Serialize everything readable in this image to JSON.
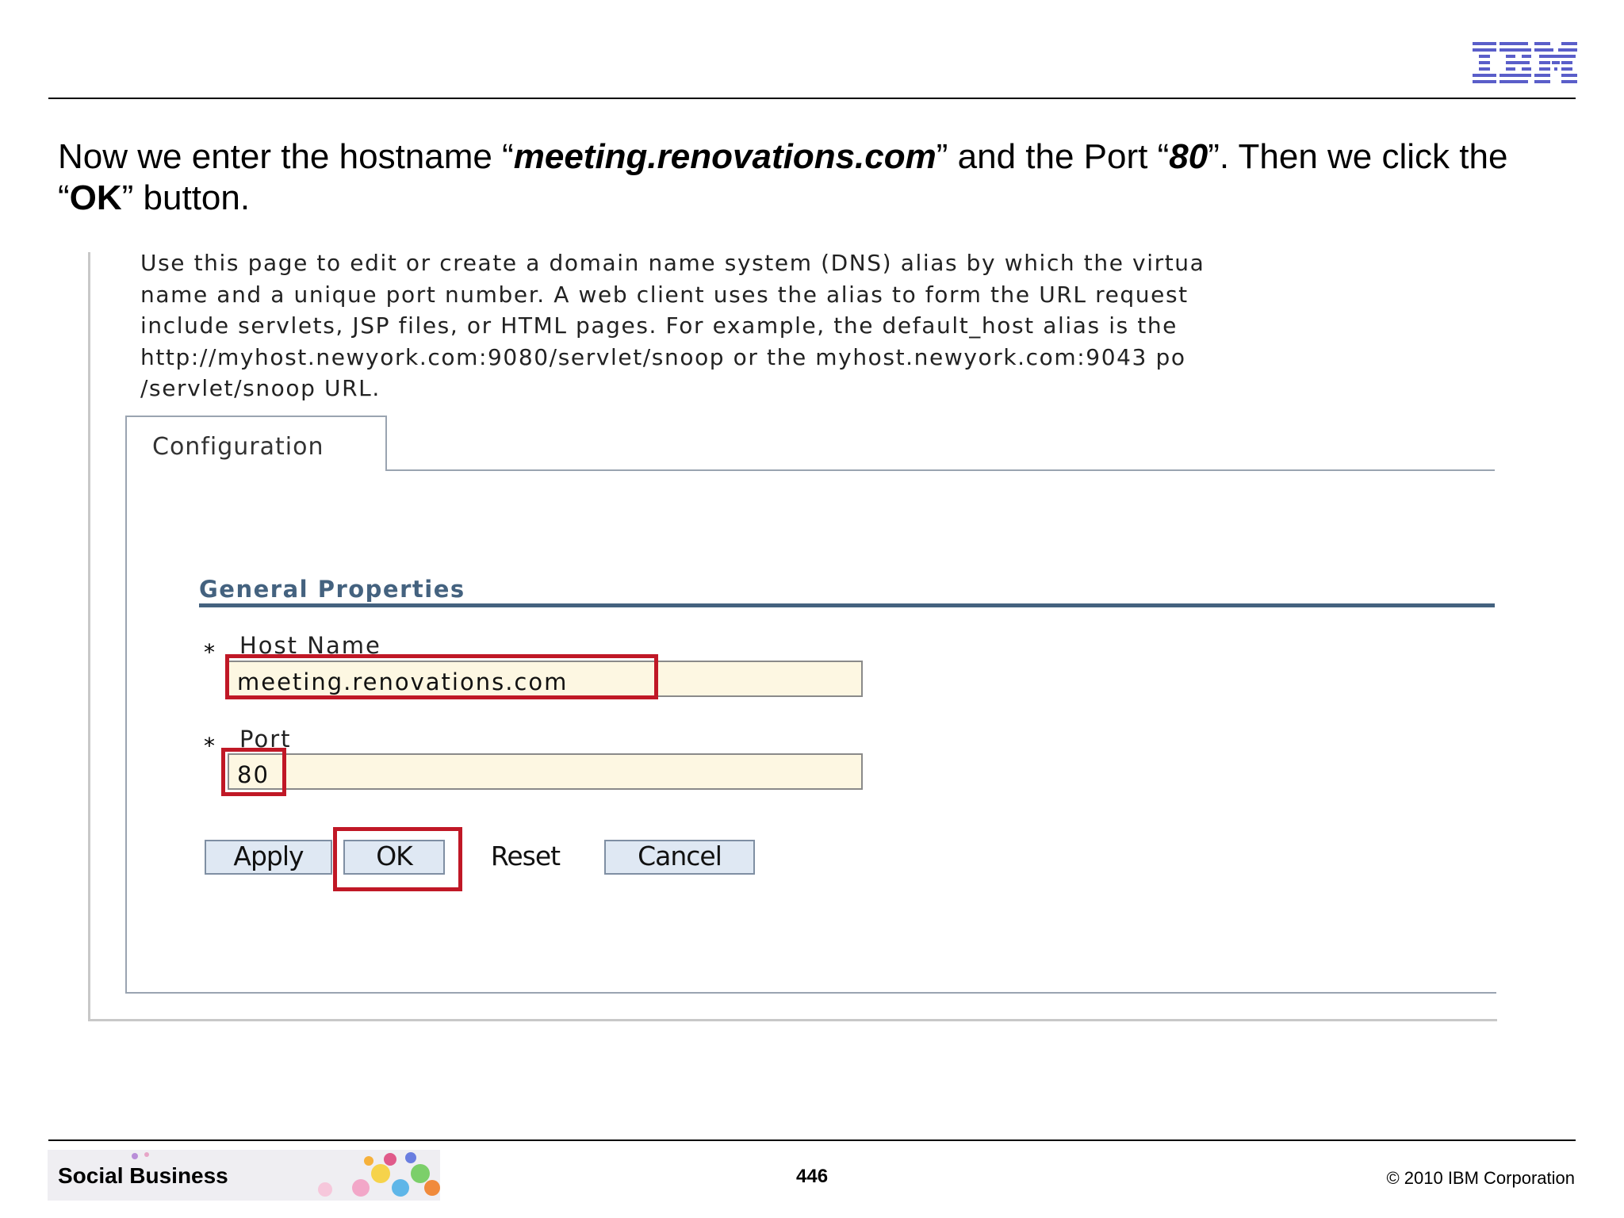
{
  "slide": {
    "caption": {
      "part1": "Now we enter the hostname “",
      "hostname": "meeting.renovations.com",
      "part2": "” and the Port “",
      "port": "80",
      "part3": "”. Then we click the “",
      "ok": "OK",
      "part4": "” button."
    },
    "footer": {
      "brand": "Social Business",
      "page_number": "446",
      "copyright": "© 2010 IBM Corporation"
    }
  },
  "screenshot": {
    "description_lines": [
      "Use this page to edit or create a domain name system (DNS) alias by which the virtua",
      "name and a unique port number. A web client uses the alias to form the URL request",
      "include servlets, JSP files, or HTML pages. For example, the default_host alias is the",
      "http://myhost.newyork.com:9080/servlet/snoop or the myhost.newyork.com:9043 po",
      "/servlet/snoop URL."
    ],
    "tab_label": "Configuration",
    "section_title": "General Properties",
    "required_marker": "*",
    "host_name": {
      "label": "Host Name",
      "value": "meeting.renovations.com"
    },
    "port": {
      "label": "Port",
      "value": "80"
    },
    "buttons": {
      "apply": "Apply",
      "ok": "OK",
      "reset": "Reset",
      "cancel": "Cancel"
    }
  },
  "colors": {
    "highlight": "#c01826",
    "field_bg": "#fdf7e2",
    "section_title": "#44627f",
    "ibm_logo": "#5a5ec9"
  }
}
